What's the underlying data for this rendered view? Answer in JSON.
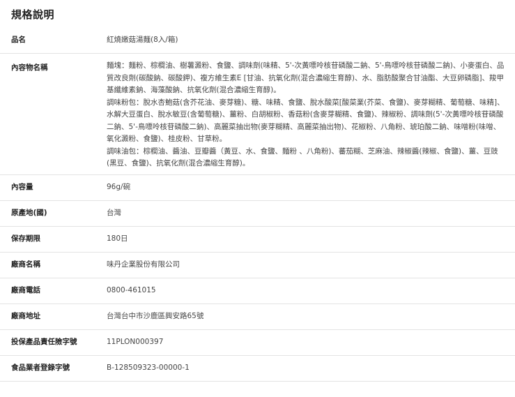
{
  "section_title": "規格說明",
  "rows": [
    {
      "label": "品名",
      "value": "紅燒嫩菇湯麵(8入/箱)"
    },
    {
      "label": "內容物名稱",
      "paragraphs": [
        "麵塊：麵粉、棕櫚油、樹薯澱粉、食鹽、調味劑(味精、5'-次黃嘌呤核苷磷酸二鈉、5'-鳥嘌呤核苷磷酸二鈉)、小麥蛋白、品質改良劑(碳酸鈉、碳酸鉀)、複方維生素E [甘油、抗氧化劑(混合濃縮生育醇)、水、脂肪酸聚合甘油酯、大豆卵磷脂]、羧甲基纖維素鈉、海藻酸鈉、抗氧化劑(混合濃縮生育醇)。",
        "調味粉包：脫水杏鮑菇(含芥花油、麥芽糖)、糖、味精、食鹽、脫水酸菜[酸菜業(芥菜、食鹽)、麥芽糊精、葡萄糖、味精]、水解大豆蛋白、脫水敏豆(含葡萄糖)、薑粉、白胡椒粉、香菇粉(含麥芽糊精、食鹽)、辣椒粉、調味劑(5'-次黃嘌呤核苷磷酸二鈉、5'-鳥嘌呤核苷磷酸二鈉)、高麗菜抽出物(麥芽糊精、高麗菜抽出物)、花椒粉、八角粉、琥珀酸二鈉、味噌粉(味噌、氧化澱粉、食鹽)、桂皮粉、甘草粉。",
        "調味油包：棕櫚油、醬油、豆瓣醬（黃豆、水、食鹽、麵粉 、八角粉)、蕃茄糊、芝麻油、辣椒醬(辣椒、食鹽)、薑、豆豉(黑豆、食鹽)、抗氧化劑(混合濃縮生育醇)。"
      ]
    },
    {
      "label": "內容量",
      "value": "96g/碗"
    },
    {
      "label": "原產地(國)",
      "value": "台灣"
    },
    {
      "label": "保存期限",
      "value": "180日"
    },
    {
      "label": "廠商名稱",
      "value": "味丹企業股份有限公司"
    },
    {
      "label": "廠商電話",
      "value": "0800-461015"
    },
    {
      "label": "廠商地址",
      "value": "台灣台中市沙鹿區興安路65號"
    },
    {
      "label": "投保產品責任險字號",
      "value": "11PLON000397"
    },
    {
      "label": "食品業者登錄字號",
      "value": "B-128509323-00000-1"
    }
  ]
}
